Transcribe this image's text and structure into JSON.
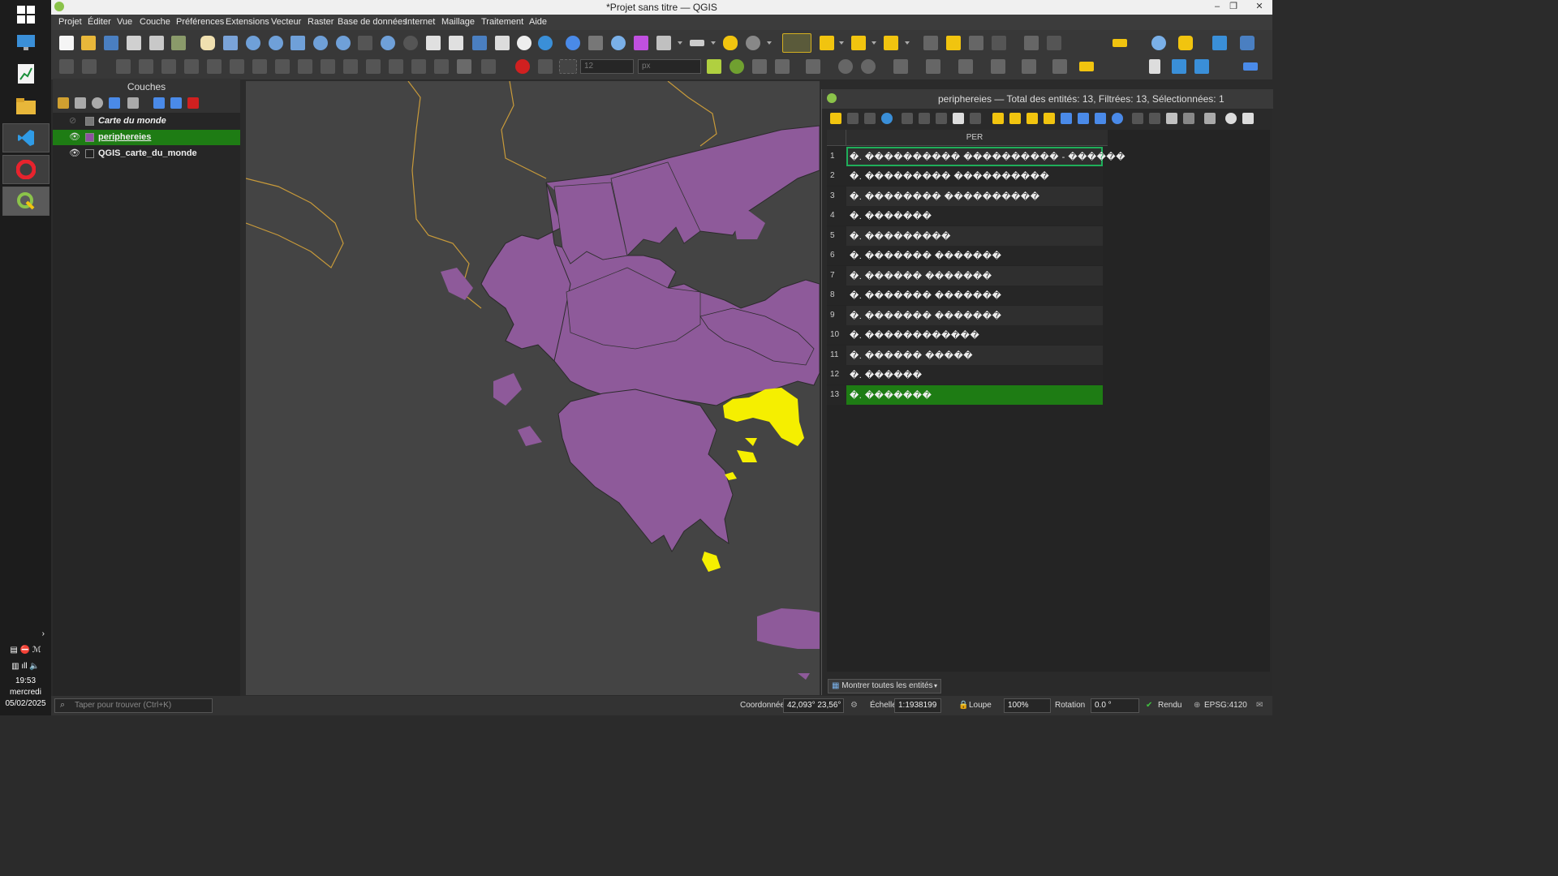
{
  "window": {
    "title": "*Projet sans titre — QGIS",
    "controls": [
      "–",
      "❐",
      "✕"
    ]
  },
  "menu": [
    "Projet",
    "Éditer",
    "Vue",
    "Couche",
    "Préférences",
    "Extensions",
    "Vecteur",
    "Raster",
    "Base de données",
    "Internet",
    "Maillage",
    "Traitement",
    "Aide"
  ],
  "toolbar": {
    "font_size_value": "12",
    "unit_value": "px"
  },
  "layers_panel": {
    "title": "Couches",
    "layers": [
      {
        "name": "Carte du monde",
        "visible": false,
        "selected": false,
        "swatch": "#777777"
      },
      {
        "name": "periphereies",
        "visible": true,
        "selected": true,
        "swatch": "#8e51a0"
      },
      {
        "name": "QGIS_carte_du_monde",
        "visible": true,
        "selected": false,
        "swatch": "#222222"
      }
    ]
  },
  "map": {
    "background": "#444444",
    "region_fill": "#8e5a9a",
    "selected_fill": "#f5ef00",
    "border_color": "#c89a3a"
  },
  "attribute_table": {
    "title": "periphereies — Total des entités: 13, Filtrées: 13, Sélectionnées: 1",
    "column": "PER",
    "rows": [
      {
        "n": "1",
        "value": "�. ���������� ���������� - ������"
      },
      {
        "n": "2",
        "value": "�. ��������� ����������"
      },
      {
        "n": "3",
        "value": "�. �������� ����������"
      },
      {
        "n": "4",
        "value": "�. �������"
      },
      {
        "n": "5",
        "value": "�. ���������"
      },
      {
        "n": "6",
        "value": "�. ������� �������"
      },
      {
        "n": "7",
        "value": "�. ������ �������"
      },
      {
        "n": "8",
        "value": "�. ������� �������"
      },
      {
        "n": "9",
        "value": "�. ������� �������"
      },
      {
        "n": "10",
        "value": "�. ������������"
      },
      {
        "n": "11",
        "value": "�. ������ �����"
      },
      {
        "n": "12",
        "value": "�. ������"
      },
      {
        "n": "13",
        "value": "�. �������"
      }
    ],
    "focused_row": "1",
    "selected_row": "13",
    "show_all_label": "Montrer toutes les entités"
  },
  "statusbar": {
    "search_placeholder": "Taper pour trouver (Ctrl+K)",
    "coord_label": "Coordonnée",
    "coord_value": "42,093° 23,56°",
    "scale_label": "Échelle",
    "scale_value": "1:1938199",
    "magnifier_label": "Loupe",
    "magnifier_value": "100%",
    "rotation_label": "Rotation",
    "rotation_value": "0.0 °",
    "render_label": "Rendu",
    "crs": "EPSG:4120"
  },
  "taskbar": {
    "time": "19:53",
    "day": "mercredi",
    "date": "05/02/2025"
  }
}
